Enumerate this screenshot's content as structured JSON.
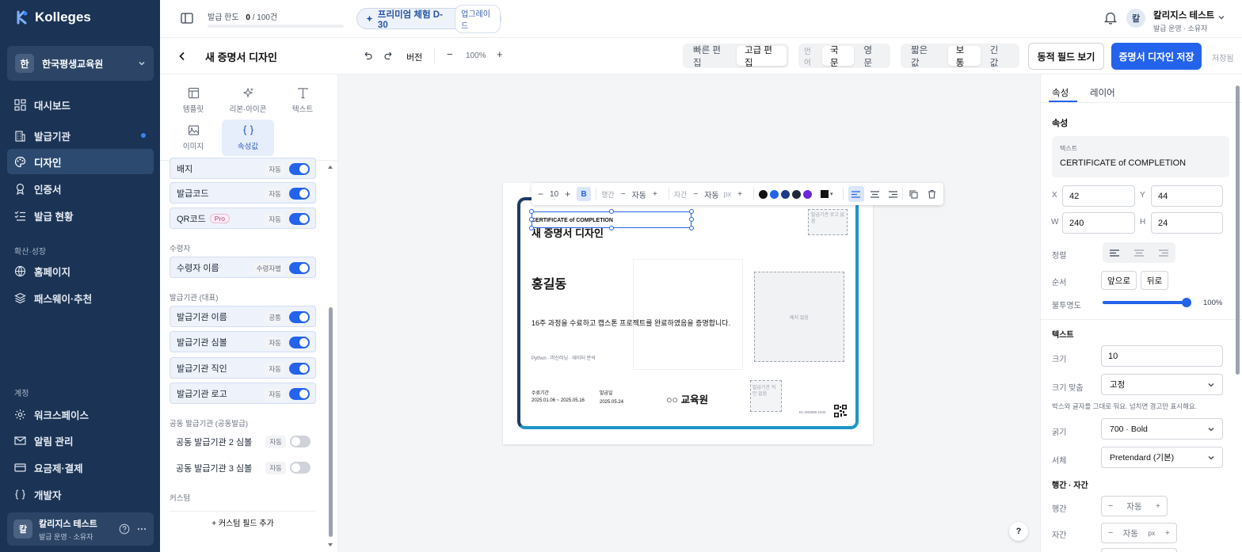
{
  "app": {
    "logo": "Kolleges"
  },
  "org": {
    "badge": "한",
    "name": "한국평생교육원"
  },
  "nav": [
    {
      "label": "대시보드"
    },
    {
      "label": "발급기관"
    },
    {
      "label": "디자인"
    },
    {
      "label": "인증서"
    },
    {
      "label": "발급 현황"
    },
    {
      "label": "홈페이지"
    },
    {
      "label": "패스웨이·추천"
    },
    {
      "label": "워크스페이스"
    },
    {
      "label": "알림 관리"
    },
    {
      "label": "요금제·결제"
    },
    {
      "label": "개발자"
    }
  ],
  "nav_sections": {
    "growth": "확산·성장",
    "account": "계정"
  },
  "user": {
    "avatar": "칼",
    "name": "칼리지스 테스트",
    "role": "발급 운영 · 소유자"
  },
  "topbar": {
    "quota_label": "발급 한도",
    "quota_value": "0",
    "quota_total": "/ 100건",
    "trial": "프리미엄 체험 D-30",
    "upgrade": "업그레이드",
    "account_name": "칼리지스 테스트",
    "account_role": "발급 운영 · 소유자",
    "account_avatar": "칼"
  },
  "editor": {
    "title": "새 증명서 디자인",
    "version": "버전",
    "zoom": "100%",
    "mode_quick": "빠른 편집",
    "mode_advanced": "고급 편집",
    "lang_label": "언어",
    "lang_ko": "국문",
    "lang_en": "영문",
    "len_short": "짧은 값",
    "len_normal": "보통",
    "len_long": "긴 값",
    "dynamic_fields": "동적 필드 보기",
    "save": "증명서 디자인 저장",
    "saved_status": "저장됨"
  },
  "tools": [
    {
      "label": "템플릿"
    },
    {
      "label": "리본·아이콘"
    },
    {
      "label": "텍스트"
    },
    {
      "label": "이미지"
    },
    {
      "label": "속성값"
    }
  ],
  "fields": {
    "group_recipient": "수령자",
    "group_issuer": "발급기관 (대표)",
    "group_co": "공동 발급기관 (공동발급)",
    "group_custom": "커스텀",
    "top": [
      {
        "label": "배지",
        "mode": "자동",
        "on": true
      },
      {
        "label": "발급코드",
        "mode": "자동",
        "on": true
      },
      {
        "label": "QR코드",
        "pro": "Pro",
        "mode": "자동",
        "on": true
      }
    ],
    "recipient": [
      {
        "label": "수령자 이름",
        "mode": "수령자별",
        "on": true
      }
    ],
    "issuer": [
      {
        "label": "발급기관 이름",
        "mode": "공통",
        "on": true
      },
      {
        "label": "발급기관 심볼",
        "mode": "자동",
        "on": true
      },
      {
        "label": "발급기관 직인",
        "mode": "자동",
        "on": true
      },
      {
        "label": "발급기관 로고",
        "mode": "자동",
        "on": true
      }
    ],
    "co": [
      {
        "label": "공동 발급기관 2 심볼",
        "mode": "자동",
        "on": false
      },
      {
        "label": "공동 발급기관 3 심볼",
        "mode": "자동",
        "on": false
      }
    ],
    "add_custom": "+ 커스텀 필드 추가"
  },
  "certificate": {
    "heading_en": "CERTIFICATE of COMPLETION",
    "title": "새 증명서 디자인",
    "logo_placeholder": "발급기관 로고 없음",
    "recipient": "홍길동",
    "body": "16주 과정을 수료하고 캡스톤 프로젝트를 완료하였음을 증명합니다.",
    "skills": "Python · 머신러닝 · 데이터 분석",
    "badge_placeholder": "배지 없음",
    "period_label": "수료기간",
    "period": "2025.01.06 ~ 2025.05.16",
    "issue_label": "발급일",
    "issue_date": "2025.05.24",
    "issuer_name": "○○ 교육원",
    "seal_placeholder": "발급기관 직인 없음",
    "code": "KL-202505-1042"
  },
  "text_toolbar": {
    "size": "10",
    "bold": "B",
    "line_label": "행간",
    "line_value": "자동",
    "letter_label": "자간",
    "letter_value": "자동",
    "letter_unit": "px",
    "colors": [
      "#111111",
      "#2563eb",
      "#1e3a8a",
      "#1f2937",
      "#6d28d9"
    ],
    "current_color": "#111111"
  },
  "props": {
    "tab_props": "속성",
    "tab_layer": "레이어",
    "section": "속성",
    "text_label": "텍스트",
    "text_value": "CERTIFICATE of COMPLETION",
    "x_label": "X",
    "x": "42",
    "y_label": "Y",
    "y": "44",
    "w_label": "W",
    "w": "240",
    "h_label": "H",
    "h": "24",
    "align_label": "정렬",
    "order_label": "순서",
    "order_front": "앞으로",
    "order_back": "뒤로",
    "opacity_label": "불투명도",
    "opacity": "100%",
    "opacity_fraction": 1.0,
    "text_section": "텍스트",
    "size_label": "크기",
    "size": "10",
    "fit_label": "크기 맞춤",
    "fit": "고정",
    "fit_hint": "박스와 글자를 그대로 둬요. 넘치면 경고만 표시해요.",
    "weight_label": "굵기",
    "weight": "700 · Bold",
    "font_label": "서체",
    "font": "Pretendard (기본)",
    "spacing_section": "행간 · 자간",
    "line_label": "행간",
    "line_value": "자동",
    "letter_label": "자간",
    "letter_value": "자동",
    "letter_unit": "px"
  },
  "help": "?"
}
